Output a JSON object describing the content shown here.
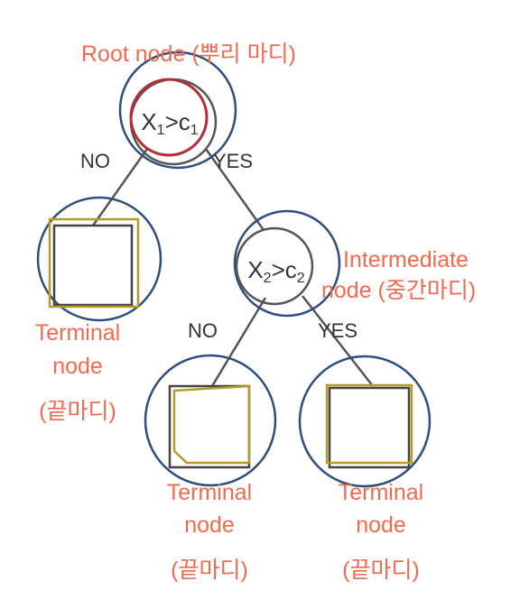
{
  "colors": {
    "label": "#f26a4f",
    "edge_text": "#333333",
    "outer_circle": "#2d4e7e",
    "root_circle": "#b32e36",
    "square_gold": "#b59b2c",
    "square_dark": "#444444"
  },
  "root": {
    "label": "Root node (뿌리 마디)",
    "cond_var": "X",
    "cond_var_sub": "1",
    "cond_op": ">c",
    "cond_const_sub": "1"
  },
  "intermediate": {
    "label_line1": "Intermediate",
    "label_line2": "node (중간마디)",
    "cond_var": "X",
    "cond_var_sub": "2",
    "cond_op": ">c",
    "cond_const_sub": "2"
  },
  "edges": {
    "root_no": "NO",
    "root_yes": "YES",
    "mid_no": "NO",
    "mid_yes": "YES"
  },
  "terminal_left": {
    "line1": "Terminal",
    "line2": "node",
    "line3": "(끝마디)"
  },
  "terminal_mid": {
    "line1": "Terminal",
    "line2": "node",
    "line3": "(끝마디)"
  },
  "terminal_right": {
    "line1": "Terminal",
    "line2": "node",
    "line3": "(끝마디)"
  }
}
